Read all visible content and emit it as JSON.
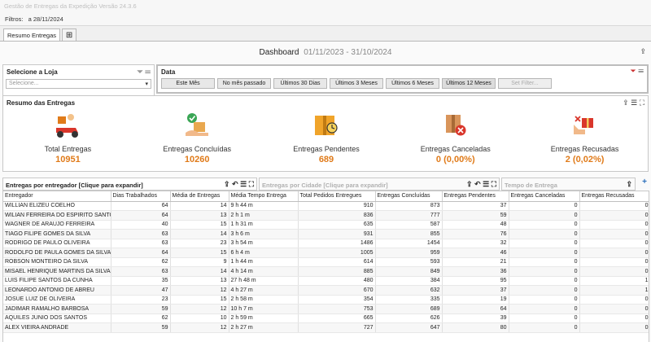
{
  "window": {
    "title": "Gestão de Entregas da Expedição Versão 24.3.6"
  },
  "filters": {
    "label": "Filtros:",
    "value": "a 28/11/2024"
  },
  "tabs": [
    {
      "label": "Resumo Entregas"
    }
  ],
  "dashboard": {
    "title": "Dashboard",
    "period": "01/11/2023 - 31/10/2024"
  },
  "loja": {
    "title": "Selecione a Loja",
    "placeholder": "Selecione..."
  },
  "date_filter": {
    "title": "Data",
    "buttons": [
      "Este Mês",
      "No mês passado",
      "Últimos 30 Dias",
      "Últimos 3 Meses",
      "Últimos 6 Meses",
      "Últimos 12 Meses",
      "Set Filter..."
    ]
  },
  "resumo": {
    "title": "Resumo das Entregas",
    "kpis": [
      {
        "label": "Total Entregas",
        "value": "10951",
        "pct": "",
        "icon": "delivery-scooter-icon"
      },
      {
        "label": "Entregas Concluídas",
        "value": "10260",
        "pct": "",
        "icon": "package-check-icon"
      },
      {
        "label": "Entregas Pendentes",
        "value": "689",
        "pct": "",
        "icon": "package-clock-icon"
      },
      {
        "label": "Entregas Canceladas",
        "value": "0",
        "pct": "(0,00%)",
        "icon": "package-cancel-icon"
      },
      {
        "label": "Entregas Recusadas",
        "value": "2",
        "pct": "(0,02%)",
        "icon": "gift-hand-icon"
      }
    ]
  },
  "sections": {
    "entregador": "Entregas por entregador [Clique para expandir]",
    "cidade": "Entregas por Cidade [Clique para expandir]",
    "tempo": "Tempo de Entrega"
  },
  "table": {
    "columns": [
      "Entregador",
      "Dias Trabalhados",
      "Média de Entregas",
      "Média Tempo Entrega",
      "Total Pedidos Entregues",
      "Entregas Concluídas",
      "Entregas Pendentes",
      "Entregas Canceladas",
      "Entregas Recusadas"
    ],
    "rows": [
      [
        "WILLIAN ELIZEU COELHO",
        "64",
        "14",
        "9 h 44 m",
        "910",
        "873",
        "37",
        "0",
        "0"
      ],
      [
        "WILIAN FERREIRA DO ESPIRITO SANTO",
        "64",
        "13",
        "2 h 1 m",
        "836",
        "777",
        "59",
        "0",
        "0"
      ],
      [
        "WAGNER DE ARAUJO FERREIRA",
        "40",
        "15",
        "1 h 31 m",
        "635",
        "587",
        "48",
        "0",
        "0"
      ],
      [
        "TIAGO FILIPE GOMES DA SILVA",
        "63",
        "14",
        "3 h 6 m",
        "931",
        "855",
        "76",
        "0",
        "0"
      ],
      [
        "RODRIGO DE PAULO OLIVEIRA",
        "63",
        "23",
        "3 h 54 m",
        "1486",
        "1454",
        "32",
        "0",
        "0"
      ],
      [
        "RODOLFO DE PAULA GOMES DA SILVA",
        "64",
        "15",
        "6 h 4 m",
        "1005",
        "959",
        "46",
        "0",
        "0"
      ],
      [
        "ROBSON MONTEIRO DA SILVA",
        "62",
        "9",
        "1 h 44 m",
        "614",
        "593",
        "21",
        "0",
        "0"
      ],
      [
        "MISAEL HENRIQUE MARTINS DA SILVA",
        "63",
        "14",
        "4 h 14 m",
        "885",
        "849",
        "36",
        "0",
        "0"
      ],
      [
        "LUIS FILIPE SANTOS DA CUNHA",
        "35",
        "13",
        "27 h 48 m",
        "480",
        "384",
        "95",
        "0",
        "1"
      ],
      [
        "LEONARDO ANTONIO DE ABREU",
        "47",
        "12",
        "4 h 27 m",
        "670",
        "632",
        "37",
        "0",
        "1"
      ],
      [
        "JOSUE LUIZ DE OLIVEIRA",
        "23",
        "15",
        "2 h 58 m",
        "354",
        "335",
        "19",
        "0",
        "0"
      ],
      [
        "JADIMAR RAMALHO BARBOSA",
        "59",
        "12",
        "10 h 7 m",
        "753",
        "689",
        "64",
        "0",
        "0"
      ],
      [
        "AQUILES JUNIO DOS SANTOS",
        "62",
        "10",
        "2 h 59 m",
        "665",
        "626",
        "39",
        "0",
        "0"
      ],
      [
        "ALEX VIEIRA ANDRADE",
        "59",
        "12",
        "2 h 27 m",
        "727",
        "647",
        "80",
        "0",
        "0"
      ]
    ]
  }
}
